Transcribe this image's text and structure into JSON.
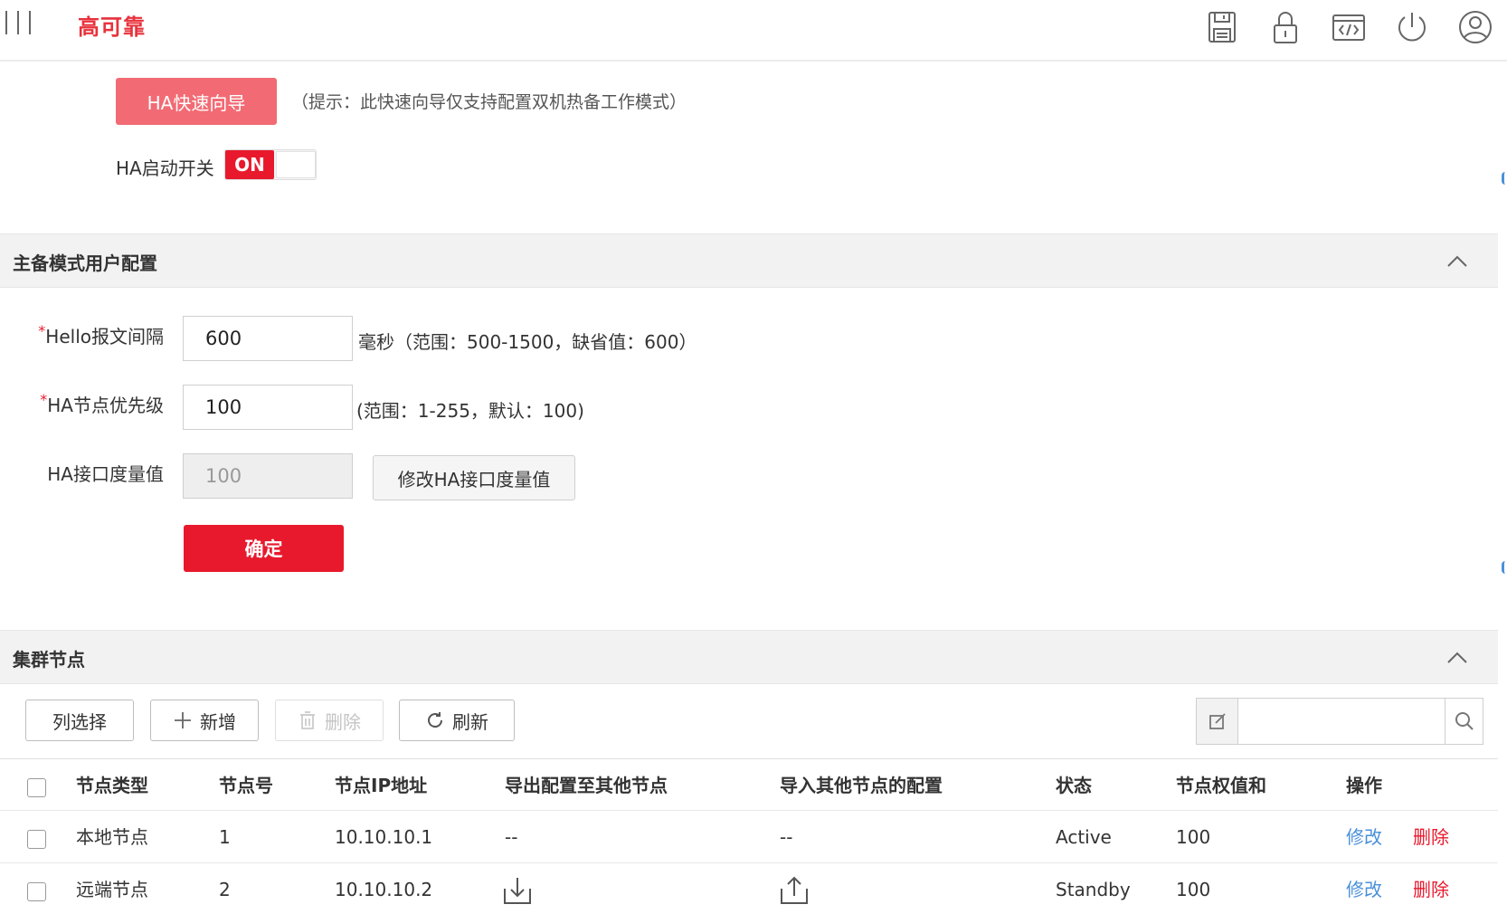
{
  "header": {
    "title": "高可靠"
  },
  "wizard": {
    "button_label": "HA快速向导",
    "hint": "（提示：此快速向导仅支持配置双机热备工作模式）"
  },
  "ha_switch": {
    "label": "HA启动开关",
    "state": "ON"
  },
  "section_user_config": {
    "title": "主备模式用户配置"
  },
  "form": {
    "hello_interval": {
      "required_mark": "*",
      "label": "Hello报文间隔",
      "value": "600",
      "hint": "毫秒（范围：500-1500，缺省值：600）"
    },
    "node_priority": {
      "required_mark": "*",
      "label": "HA节点优先级",
      "value": "100",
      "hint": "(范围：1-255，默认：100)"
    },
    "interface_metric": {
      "label": "HA接口度量值",
      "value": "100",
      "button_label": "修改HA接口度量值"
    },
    "confirm_label": "确定"
  },
  "section_cluster": {
    "title": "集群节点"
  },
  "toolbar": {
    "column_select": "列选择",
    "add": "新增",
    "delete": "删除",
    "refresh": "刷新",
    "search_value": ""
  },
  "table": {
    "columns": [
      "节点类型",
      "节点号",
      "节点IP地址",
      "导出配置至其他节点",
      "导入其他节点的配置",
      "状态",
      "节点权值和",
      "操作"
    ],
    "rows": [
      {
        "type": "本地节点",
        "node_no": "1",
        "ip": "10.10.10.1",
        "export": "--",
        "import": "--",
        "status": "Active",
        "weight": "100",
        "edit": "修改",
        "delete": "删除"
      },
      {
        "type": "远端节点",
        "node_no": "2",
        "ip": "10.10.10.2",
        "export_icon": "download-tray-icon",
        "import_icon": "upload-tray-icon",
        "status": "Standby",
        "weight": "100",
        "edit": "修改",
        "delete": "删除"
      }
    ]
  },
  "colors": {
    "accent": "#e8192c",
    "wizard": "#f26b74",
    "link": "#4a90d9",
    "title": "#e8323c"
  }
}
